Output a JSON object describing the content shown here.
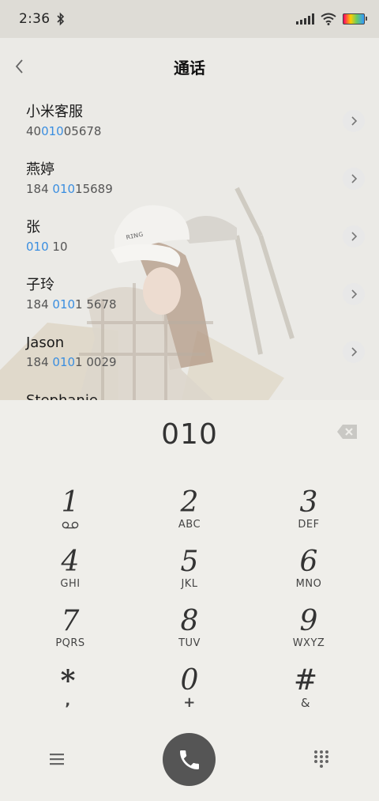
{
  "status_bar": {
    "time": "2:36"
  },
  "header": {
    "title": "通话"
  },
  "contacts": [
    {
      "name": "小米客服",
      "number_pre": "40",
      "number_hl": "010",
      "number_post": "05678"
    },
    {
      "name": "燕婷",
      "number_pre": "184 ",
      "number_hl": "010",
      "number_post": "15689"
    },
    {
      "name": "张",
      "number_pre": "",
      "number_hl": "010",
      "number_post": " 10"
    },
    {
      "name": "子玲",
      "number_pre": "184 ",
      "number_hl": "010",
      "number_post": "1 5678"
    },
    {
      "name": "Jason",
      "number_pre": "184 ",
      "number_hl": "010",
      "number_post": "1 0029"
    },
    {
      "name": "Stephanie",
      "number_pre": "",
      "number_hl": "",
      "number_post": ""
    }
  ],
  "dialer": {
    "number": "010",
    "keys": [
      {
        "digit": "1",
        "sub": ""
      },
      {
        "digit": "2",
        "sub": "ABC"
      },
      {
        "digit": "3",
        "sub": "DEF"
      },
      {
        "digit": "4",
        "sub": "GHI"
      },
      {
        "digit": "5",
        "sub": "JKL"
      },
      {
        "digit": "6",
        "sub": "MNO"
      },
      {
        "digit": "7",
        "sub": "PQRS"
      },
      {
        "digit": "8",
        "sub": "TUV"
      },
      {
        "digit": "9",
        "sub": "WXYZ"
      },
      {
        "digit": "*",
        "sub": ","
      },
      {
        "digit": "0",
        "sub": "+"
      },
      {
        "digit": "#",
        "sub": "&"
      }
    ]
  },
  "icons": {
    "back": "chevron-left-icon",
    "contact_detail": "chevron-right-icon",
    "backspace": "backspace-icon",
    "voicemail": "voicemail-icon",
    "menu": "menu-icon",
    "call": "phone-icon",
    "keypad": "dialpad-icon"
  },
  "colors": {
    "highlight": "#3a8ee0",
    "call_button": "#555555",
    "background": "#efeeea"
  }
}
